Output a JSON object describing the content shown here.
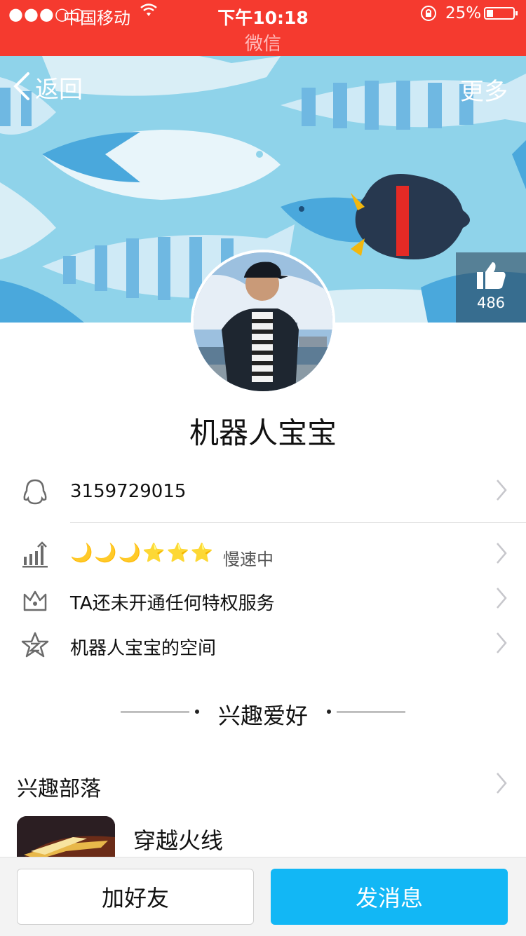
{
  "status_bar": {
    "signal": "●●●○○",
    "carrier": "中国移动",
    "time": "下午10:18",
    "battery": "25%",
    "app_name": "微信"
  },
  "nav": {
    "back_label": "返回",
    "more_label": "更多"
  },
  "like": {
    "count": "486"
  },
  "profile": {
    "name": "机器人宝宝",
    "qq_number": "3159729015",
    "level_icons": "🌙🌙🌙⭐⭐⭐",
    "level_status": "慢速中",
    "privilege": "TA还未开通任何特权服务",
    "space": "机器人宝宝的空间"
  },
  "hobby": {
    "section_title": "兴趣爱好",
    "tribe_title": "兴趣部落",
    "game_name": "穿越火线"
  },
  "actions": {
    "add_friend": "加好友",
    "send_message": "发消息"
  },
  "colors": {
    "status_bar": "#f53a2f",
    "cover_bg": "#8fd3ea",
    "primary_button": "#12b7f5"
  }
}
